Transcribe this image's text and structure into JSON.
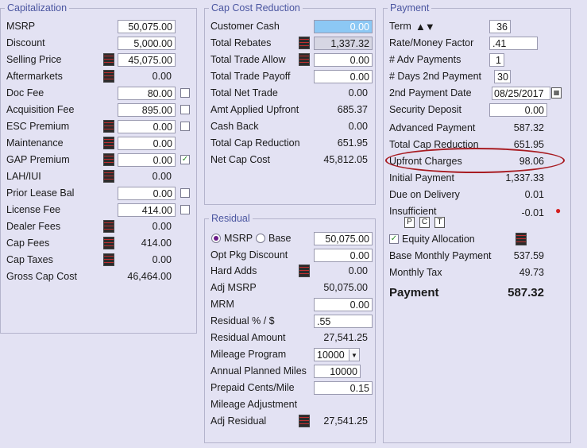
{
  "capitalization": {
    "title": "Capitalization",
    "msrp": {
      "label": "MSRP",
      "value": "50,075.00"
    },
    "discount": {
      "label": "Discount",
      "value": "5,000.00"
    },
    "selling_price": {
      "label": "Selling Price",
      "value": "45,075.00"
    },
    "aftermarkets": {
      "label": "Aftermarkets",
      "value": "0.00"
    },
    "doc_fee": {
      "label": "Doc Fee",
      "value": "80.00"
    },
    "acquisition_fee": {
      "label": "Acquisition Fee",
      "value": "895.00"
    },
    "esc_premium": {
      "label": "ESC Premium",
      "value": "0.00"
    },
    "maintenance": {
      "label": "Maintenance",
      "value": "0.00"
    },
    "gap_premium": {
      "label": "GAP Premium",
      "value": "0.00",
      "checkmark": "✓"
    },
    "lah_iui": {
      "label": "LAH/IUI",
      "value": "0.00"
    },
    "prior_lease_bal": {
      "label": "Prior Lease Bal",
      "value": "0.00"
    },
    "license_fee": {
      "label": "License Fee",
      "value": "414.00"
    },
    "dealer_fees": {
      "label": "Dealer Fees",
      "value": "0.00"
    },
    "cap_fees": {
      "label": "Cap Fees",
      "value": "414.00"
    },
    "cap_taxes": {
      "label": "Cap Taxes",
      "value": "0.00"
    },
    "gross_cap_cost": {
      "label": "Gross Cap Cost",
      "value": "46,464.00"
    }
  },
  "cap_cost_reduction": {
    "title": "Cap Cost Reduction",
    "customer_cash": {
      "label": "Customer Cash",
      "value": "0.00"
    },
    "total_rebates": {
      "label": "Total Rebates",
      "value": "1,337.32"
    },
    "total_trade_allow": {
      "label": "Total Trade Allow",
      "value": "0.00"
    },
    "total_trade_payoff": {
      "label": "Total Trade Payoff",
      "value": "0.00"
    },
    "total_net_trade": {
      "label": "Total Net Trade",
      "value": "0.00"
    },
    "amt_applied_upfront": {
      "label": "Amt Applied Upfront",
      "value": "685.37"
    },
    "cash_back": {
      "label": "Cash Back",
      "value": "0.00"
    },
    "total_cap_reduction": {
      "label": "Total Cap Reduction",
      "value": "651.95"
    },
    "net_cap_cost": {
      "label": "Net Cap Cost",
      "value": "45,812.05"
    }
  },
  "residual": {
    "title": "Residual",
    "msrp_radio": "MSRP",
    "base_radio": "Base",
    "base_value": "50,075.00",
    "opt_pkg_discount": {
      "label": "Opt Pkg Discount",
      "value": "0.00"
    },
    "hard_adds": {
      "label": "Hard Adds",
      "value": "0.00"
    },
    "adj_msrp": {
      "label": "Adj MSRP",
      "value": "50,075.00"
    },
    "mrm": {
      "label": "MRM",
      "value": "0.00"
    },
    "residual_pct": {
      "label": "Residual % / $",
      "value": ".55"
    },
    "residual_amount": {
      "label": "Residual Amount",
      "value": "27,541.25"
    },
    "mileage_program": {
      "label": "Mileage Program",
      "value": "10000"
    },
    "annual_planned_miles": {
      "label": "Annual Planned Miles",
      "value": "10000"
    },
    "prepaid_cents_mile": {
      "label": "Prepaid Cents/Mile",
      "value": "0.15"
    },
    "mileage_adjustment": {
      "label": "Mileage Adjustment"
    },
    "adj_residual": {
      "label": "Adj Residual",
      "value": "27,541.25"
    }
  },
  "payment": {
    "title": "Payment",
    "term": {
      "label": "Term",
      "value": "36",
      "arrows": "▲▼"
    },
    "rate_money_factor": {
      "label": "Rate/Money Factor",
      "value": ".41"
    },
    "adv_payments": {
      "label": "# Adv Payments",
      "value": "1"
    },
    "days_2nd_payment": {
      "label": "# Days 2nd Payment",
      "value": "30"
    },
    "second_payment_date": {
      "label": "2nd Payment Date",
      "value": "08/25/2017"
    },
    "security_deposit": {
      "label": "Security Deposit",
      "value": "0.00"
    },
    "advanced_payment": {
      "label": "Advanced Payment",
      "value": "587.32"
    },
    "total_cap_reduction": {
      "label": "Total Cap Reduction",
      "value": "651.95"
    },
    "upfront_charges": {
      "label": "Upfront Charges",
      "value": "98.06"
    },
    "initial_payment": {
      "label": "Initial Payment",
      "value": "1,337.33"
    },
    "due_on_delivery": {
      "label": "Due on Delivery",
      "value": "0.01"
    },
    "insufficient": {
      "label": "Insufficient",
      "value": "-0.01"
    },
    "pct_buttons": [
      "P",
      "C",
      "T"
    ],
    "equity_allocation": {
      "label": "Equity Allocation",
      "checkmark": "✓"
    },
    "base_monthly_payment": {
      "label": "Base Monthly Payment",
      "value": "537.59"
    },
    "monthly_tax": {
      "label": "Monthly Tax",
      "value": "49.73"
    },
    "payment_total": {
      "label": "Payment",
      "value": "587.32"
    }
  },
  "colors": {
    "background": "#e3e2f3",
    "legend": "#4a55a0",
    "highlight": "#a81c22",
    "selected_input": "#8cc8f4"
  }
}
